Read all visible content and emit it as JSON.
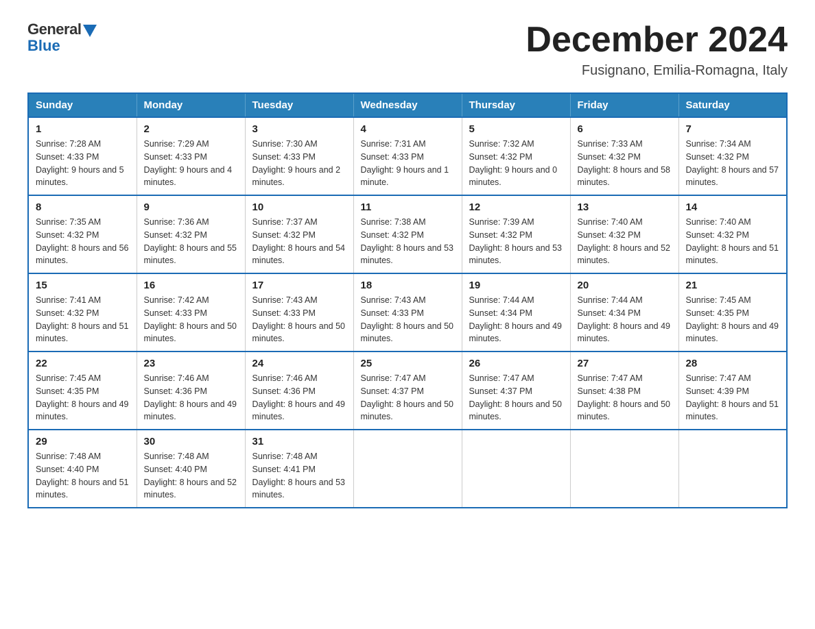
{
  "header": {
    "logo_general": "General",
    "logo_blue": "Blue",
    "month_title": "December 2024",
    "location": "Fusignano, Emilia-Romagna, Italy"
  },
  "days_of_week": [
    "Sunday",
    "Monday",
    "Tuesday",
    "Wednesday",
    "Thursday",
    "Friday",
    "Saturday"
  ],
  "weeks": [
    [
      {
        "day": "1",
        "sunrise": "7:28 AM",
        "sunset": "4:33 PM",
        "daylight": "9 hours and 5 minutes."
      },
      {
        "day": "2",
        "sunrise": "7:29 AM",
        "sunset": "4:33 PM",
        "daylight": "9 hours and 4 minutes."
      },
      {
        "day": "3",
        "sunrise": "7:30 AM",
        "sunset": "4:33 PM",
        "daylight": "9 hours and 2 minutes."
      },
      {
        "day": "4",
        "sunrise": "7:31 AM",
        "sunset": "4:33 PM",
        "daylight": "9 hours and 1 minute."
      },
      {
        "day": "5",
        "sunrise": "7:32 AM",
        "sunset": "4:32 PM",
        "daylight": "9 hours and 0 minutes."
      },
      {
        "day": "6",
        "sunrise": "7:33 AM",
        "sunset": "4:32 PM",
        "daylight": "8 hours and 58 minutes."
      },
      {
        "day": "7",
        "sunrise": "7:34 AM",
        "sunset": "4:32 PM",
        "daylight": "8 hours and 57 minutes."
      }
    ],
    [
      {
        "day": "8",
        "sunrise": "7:35 AM",
        "sunset": "4:32 PM",
        "daylight": "8 hours and 56 minutes."
      },
      {
        "day": "9",
        "sunrise": "7:36 AM",
        "sunset": "4:32 PM",
        "daylight": "8 hours and 55 minutes."
      },
      {
        "day": "10",
        "sunrise": "7:37 AM",
        "sunset": "4:32 PM",
        "daylight": "8 hours and 54 minutes."
      },
      {
        "day": "11",
        "sunrise": "7:38 AM",
        "sunset": "4:32 PM",
        "daylight": "8 hours and 53 minutes."
      },
      {
        "day": "12",
        "sunrise": "7:39 AM",
        "sunset": "4:32 PM",
        "daylight": "8 hours and 53 minutes."
      },
      {
        "day": "13",
        "sunrise": "7:40 AM",
        "sunset": "4:32 PM",
        "daylight": "8 hours and 52 minutes."
      },
      {
        "day": "14",
        "sunrise": "7:40 AM",
        "sunset": "4:32 PM",
        "daylight": "8 hours and 51 minutes."
      }
    ],
    [
      {
        "day": "15",
        "sunrise": "7:41 AM",
        "sunset": "4:32 PM",
        "daylight": "8 hours and 51 minutes."
      },
      {
        "day": "16",
        "sunrise": "7:42 AM",
        "sunset": "4:33 PM",
        "daylight": "8 hours and 50 minutes."
      },
      {
        "day": "17",
        "sunrise": "7:43 AM",
        "sunset": "4:33 PM",
        "daylight": "8 hours and 50 minutes."
      },
      {
        "day": "18",
        "sunrise": "7:43 AM",
        "sunset": "4:33 PM",
        "daylight": "8 hours and 50 minutes."
      },
      {
        "day": "19",
        "sunrise": "7:44 AM",
        "sunset": "4:34 PM",
        "daylight": "8 hours and 49 minutes."
      },
      {
        "day": "20",
        "sunrise": "7:44 AM",
        "sunset": "4:34 PM",
        "daylight": "8 hours and 49 minutes."
      },
      {
        "day": "21",
        "sunrise": "7:45 AM",
        "sunset": "4:35 PM",
        "daylight": "8 hours and 49 minutes."
      }
    ],
    [
      {
        "day": "22",
        "sunrise": "7:45 AM",
        "sunset": "4:35 PM",
        "daylight": "8 hours and 49 minutes."
      },
      {
        "day": "23",
        "sunrise": "7:46 AM",
        "sunset": "4:36 PM",
        "daylight": "8 hours and 49 minutes."
      },
      {
        "day": "24",
        "sunrise": "7:46 AM",
        "sunset": "4:36 PM",
        "daylight": "8 hours and 49 minutes."
      },
      {
        "day": "25",
        "sunrise": "7:47 AM",
        "sunset": "4:37 PM",
        "daylight": "8 hours and 50 minutes."
      },
      {
        "day": "26",
        "sunrise": "7:47 AM",
        "sunset": "4:37 PM",
        "daylight": "8 hours and 50 minutes."
      },
      {
        "day": "27",
        "sunrise": "7:47 AM",
        "sunset": "4:38 PM",
        "daylight": "8 hours and 50 minutes."
      },
      {
        "day": "28",
        "sunrise": "7:47 AM",
        "sunset": "4:39 PM",
        "daylight": "8 hours and 51 minutes."
      }
    ],
    [
      {
        "day": "29",
        "sunrise": "7:48 AM",
        "sunset": "4:40 PM",
        "daylight": "8 hours and 51 minutes."
      },
      {
        "day": "30",
        "sunrise": "7:48 AM",
        "sunset": "4:40 PM",
        "daylight": "8 hours and 52 minutes."
      },
      {
        "day": "31",
        "sunrise": "7:48 AM",
        "sunset": "4:41 PM",
        "daylight": "8 hours and 53 minutes."
      },
      null,
      null,
      null,
      null
    ]
  ],
  "sunrise_label": "Sunrise:",
  "sunset_label": "Sunset:",
  "daylight_label": "Daylight:"
}
